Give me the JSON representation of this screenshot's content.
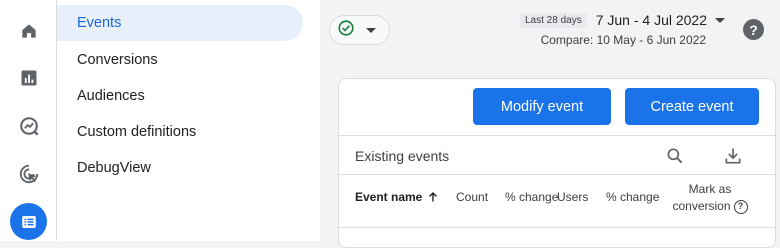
{
  "sidebar": {
    "items": [
      {
        "label": "Events",
        "active": true
      },
      {
        "label": "Conversions"
      },
      {
        "label": "Audiences"
      },
      {
        "label": "Custom definitions"
      },
      {
        "label": "DebugView"
      }
    ]
  },
  "rail": {
    "icons": [
      "home-icon",
      "reports-icon",
      "explore-icon",
      "advertising-icon",
      "configure-icon"
    ],
    "active": "configure-icon"
  },
  "header": {
    "status_icon": "check-circle-icon",
    "date_badge": "Last 28 days",
    "date_range": "7 Jun - 4 Jul 2022",
    "compare": "Compare: 10 May - 6 Jun 2022",
    "help_icon": "help-icon",
    "help_glyph": "?"
  },
  "card": {
    "modify_label": "Modify event",
    "create_label": "Create event",
    "section_title": "Existing events",
    "columns": {
      "event_name": "Event name",
      "count": "Count",
      "pct_change_1": "% change",
      "users": "Users",
      "pct_change_2": "% change",
      "mark_line1": "Mark as",
      "mark_line2": "conversion"
    }
  },
  "colors": {
    "accent": "#1a73e8",
    "active_nav_bg": "#e8f0fe",
    "active_nav_text": "#1967d2",
    "success": "#188038"
  }
}
